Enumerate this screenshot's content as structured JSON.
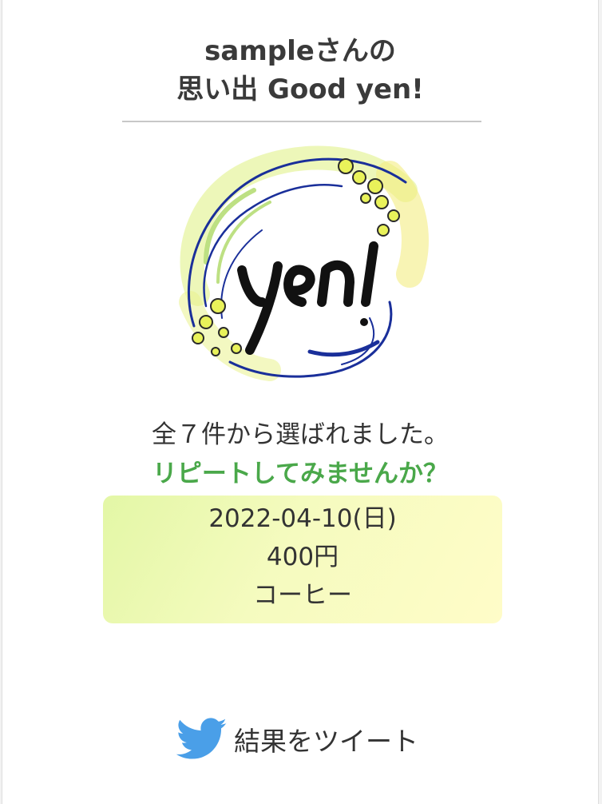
{
  "header": {
    "title_line1": "sampleさんの",
    "title_line2": "思い出 Good yen!"
  },
  "logo": {
    "text": "yen!",
    "icon": "yen-logo"
  },
  "result": {
    "message": "全７件から選ばれました。",
    "cta": "リピートしてみませんか？",
    "cta_color": "#4aa84a"
  },
  "record": {
    "date": "2022-04-10(日)",
    "amount": "400円",
    "item": "コーヒー"
  },
  "share": {
    "label": "結果をツイート",
    "icon": "twitter-bird-icon",
    "icon_color": "#4a9fe8"
  },
  "colors": {
    "page_bg": "#ffffff",
    "record_bg_start": "#e3f7a6",
    "record_bg_end": "#fffcc8",
    "text": "#333333"
  }
}
